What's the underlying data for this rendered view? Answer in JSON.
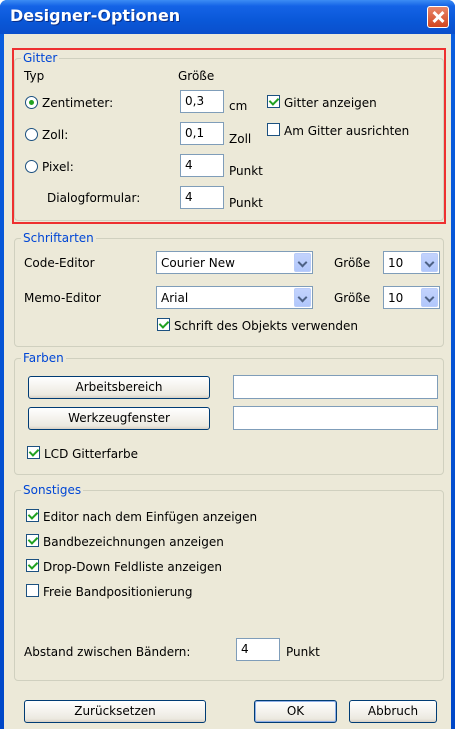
{
  "window": {
    "title": "Designer-Optionen"
  },
  "gitter": {
    "legend": "Gitter",
    "col_typ": "Typ",
    "col_groesse": "Größe",
    "zentimeter": {
      "label": "Zentimeter:",
      "value": "0,3",
      "unit": "cm",
      "selected": true
    },
    "zoll": {
      "label": "Zoll:",
      "value": "0,1",
      "unit": "Zoll",
      "selected": false
    },
    "pixel": {
      "label": "Pixel:",
      "value": "4",
      "unit": "Punkt",
      "selected": false
    },
    "dialog": {
      "label": "Dialogformular:",
      "value": "4",
      "unit": "Punkt"
    },
    "show_grid": {
      "label": "Gitter anzeigen",
      "checked": true
    },
    "align_grid": {
      "label": "Am Gitter ausrichten",
      "checked": false
    }
  },
  "schriftarten": {
    "legend": "Schriftarten",
    "code_editor": {
      "label": "Code-Editor",
      "font": "Courier New",
      "size_label": "Größe",
      "size": "10"
    },
    "memo_editor": {
      "label": "Memo-Editor",
      "font": "Arial",
      "size_label": "Größe",
      "size": "10"
    },
    "object_font": {
      "label": "Schrift des Objekts verwenden",
      "checked": true
    }
  },
  "farben": {
    "legend": "Farben",
    "workspace_button": "Arbeitsbereich",
    "toolwindow_button": "Werkzeugfenster",
    "lcd": {
      "label": "LCD Gitterfarbe",
      "checked": true
    }
  },
  "sonstiges": {
    "legend": "Sonstiges",
    "items": [
      {
        "label": "Editor nach dem Einfügen anzeigen",
        "checked": true
      },
      {
        "label": "Bandbezeichnungen anzeigen",
        "checked": true
      },
      {
        "label": "Drop-Down Feldliste anzeigen",
        "checked": true
      },
      {
        "label": "Freie Bandpositionierung",
        "checked": false
      }
    ],
    "abstand": {
      "label": "Abstand zwischen Bändern:",
      "value": "4",
      "unit": "Punkt"
    }
  },
  "footer": {
    "reset": "Zurücksetzen",
    "ok": "OK",
    "cancel": "Abbruch"
  },
  "colors": {
    "title_bar": "#0a58d8",
    "legend_text": "#0046d5",
    "highlight": "#ee3030",
    "face": "#ece9d8"
  }
}
